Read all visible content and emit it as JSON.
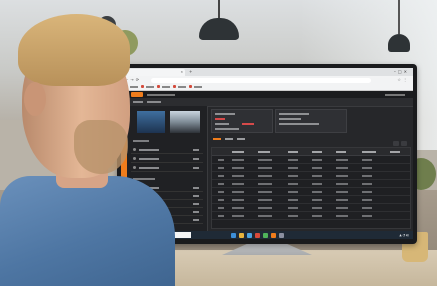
{
  "scene": {
    "description_free": true
  },
  "browser": {
    "tab_title": "",
    "url": ""
  },
  "taskbar": {
    "search_placeholder": ""
  },
  "colors": {
    "accent_orange": "#f07d1c",
    "app_dark": "#26272a",
    "shirt_blue": "#4e76a3",
    "taskbar": "#1f2a36"
  }
}
